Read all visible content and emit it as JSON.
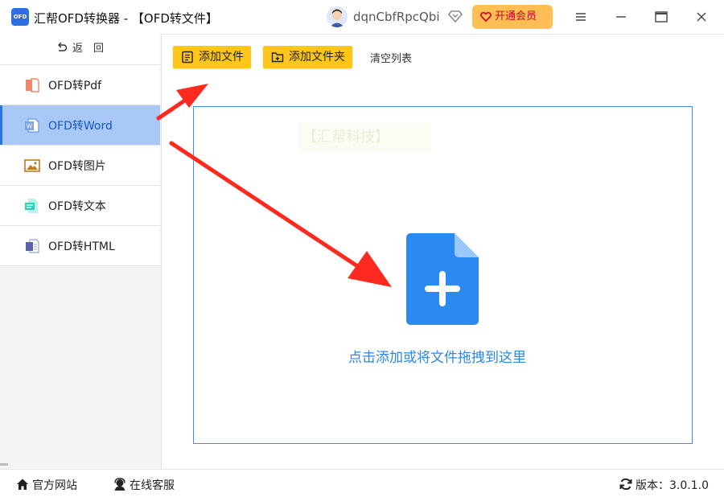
{
  "app": {
    "logo_text": "OFD",
    "title": "汇帮OFD转换器 - 【OFD转文件】",
    "username": "dqnCbfRpcQbi",
    "vip_label": "开通会员",
    "window_controls": [
      "menu-icon",
      "minimize-icon",
      "maximize-icon",
      "close-icon"
    ]
  },
  "sidebar": {
    "back_label": "返　回",
    "items": [
      {
        "label": "OFD转Pdf",
        "icon": "pdf-icon",
        "active": false
      },
      {
        "label": "OFD转Word",
        "icon": "word-icon",
        "active": true
      },
      {
        "label": "OFD转图片",
        "icon": "image-icon",
        "active": false
      },
      {
        "label": "OFD转文本",
        "icon": "text-icon",
        "active": false
      },
      {
        "label": "OFD转HTML",
        "icon": "html-icon",
        "active": false
      }
    ]
  },
  "toolbar": {
    "add_file": "添加文件",
    "add_folder": "添加文件夹",
    "clear_list": "清空列表"
  },
  "dropzone": {
    "watermark": "【汇帮科技】",
    "hint": "点击添加或将文件拖拽到这里"
  },
  "statusbar": {
    "website": "官方网站",
    "support": "在线客服",
    "version": "版本：3.0.1.0"
  },
  "colors": {
    "accent": "#2a88e6",
    "toolbar_button": "#ffc61a",
    "vip_button": "#ffbf54",
    "active_nav": "#a9c8f6",
    "arrow": "#ff2a1f"
  }
}
